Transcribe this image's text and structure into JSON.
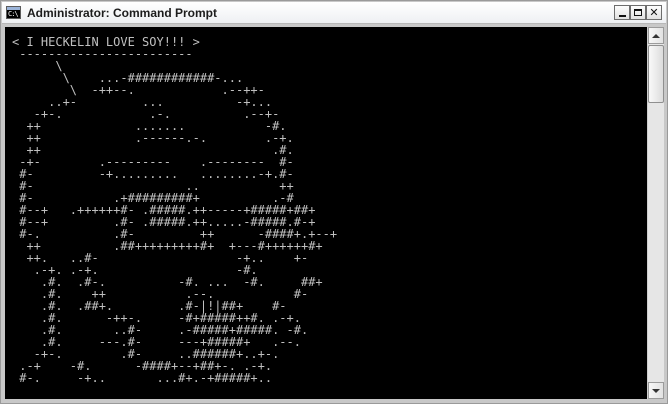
{
  "window": {
    "title": "Administrator: Command Prompt",
    "icon_name": "command-prompt-icon",
    "icon_glyph": "C:\\"
  },
  "title_controls": {
    "minimize_icon": "minimize-icon",
    "maximize_icon": "maximize-icon",
    "close_glyph": "✕"
  },
  "console": {
    "background": "#000000",
    "foreground": "#c0c0c0",
    "lines": [
      "< I HECKELIN LOVE SOY!!! >",
      " ------------------------",
      "      \\",
      "       \\    ...-############-...",
      "        \\  -++--.            .--++-",
      "     ..+-         ...          -+...",
      "   -+-.            .-.          .--+-",
      "  ++             .......           -#.",
      "  ++             .------.-.        .-+.",
      "  ++                                .#.",
      " -+-        .---------    .--------  #-",
      " #-         -+.........   ........-+.#-",
      " #-                     ..           ++",
      " #-           .+#########+          .-#",
      " #--+   .++++++#- .#####.++-----+#####+##+",
      " #--+         .#- .#####.++.....-#####.#-+",
      " #-.          .#-         ++      -####+.+--+",
      "  ++          .##+++++++++#+  +---#++++++#+",
      "  ++.   ..#-                   -+..    +-",
      "   .-+. .-+.                   -#.",
      "    .#.  .#-.          -#. ...  -#.     ##+",
      "    .#.    ++           .--.           #-",
      "    .#.  .##+.         .#-|!|##+    #-",
      "    .#.      -++-.     -#+#####++#. .-+.",
      "    .#.       ..#-     .-#####+#####. -#.",
      "    .#.     ---.#-     ---+#####+   .--.",
      "   -+-.        .#-     ..######+..+-.",
      " .-+    -#.      -####+--+##+-. .-+.",
      " #-.     -+..       ...#+.-+#####+.."
    ]
  },
  "scrollbar": {
    "up_icon": "scroll-up-arrow-icon",
    "down_icon": "scroll-down-arrow-icon"
  }
}
